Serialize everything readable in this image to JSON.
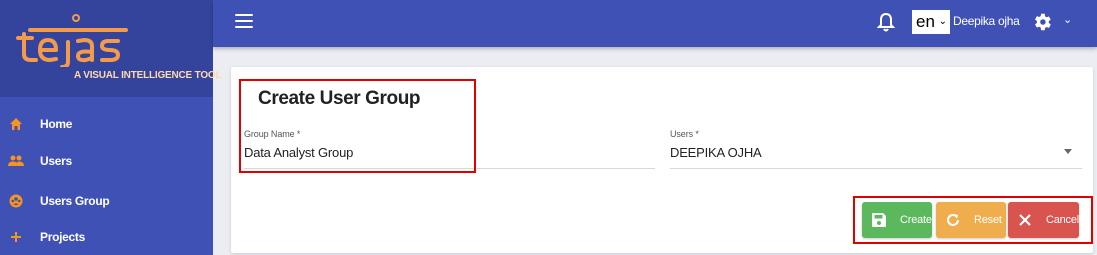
{
  "brand": {
    "logo_text": "tejas",
    "tagline": "A VISUAL INTELLIGENCE TOOL",
    "logo_color": "#f39a4b"
  },
  "sidebar": {
    "items": [
      {
        "label": "Home",
        "icon": "home-icon"
      },
      {
        "label": "Users",
        "icon": "users-icon"
      },
      {
        "label": "Users Group",
        "icon": "users-group-icon"
      },
      {
        "label": "Projects",
        "icon": "plus-icon"
      }
    ],
    "icon_color": "#f7931e"
  },
  "header": {
    "language": "en",
    "user_name": "Deepika ojha"
  },
  "form": {
    "title": "Create User Group",
    "group_name": {
      "label": "Group Name *",
      "value": "Data Analyst Group"
    },
    "users": {
      "label": "Users *",
      "value": "DEEPIKA OJHA"
    }
  },
  "actions": {
    "create_label": "Create",
    "reset_label": "Reset",
    "cancel_label": "Cancel"
  },
  "colors": {
    "primary": "#3f51b5",
    "create": "#5cb85c",
    "reset": "#f0ad4e",
    "cancel": "#d9534f",
    "highlight": "#e00000"
  }
}
